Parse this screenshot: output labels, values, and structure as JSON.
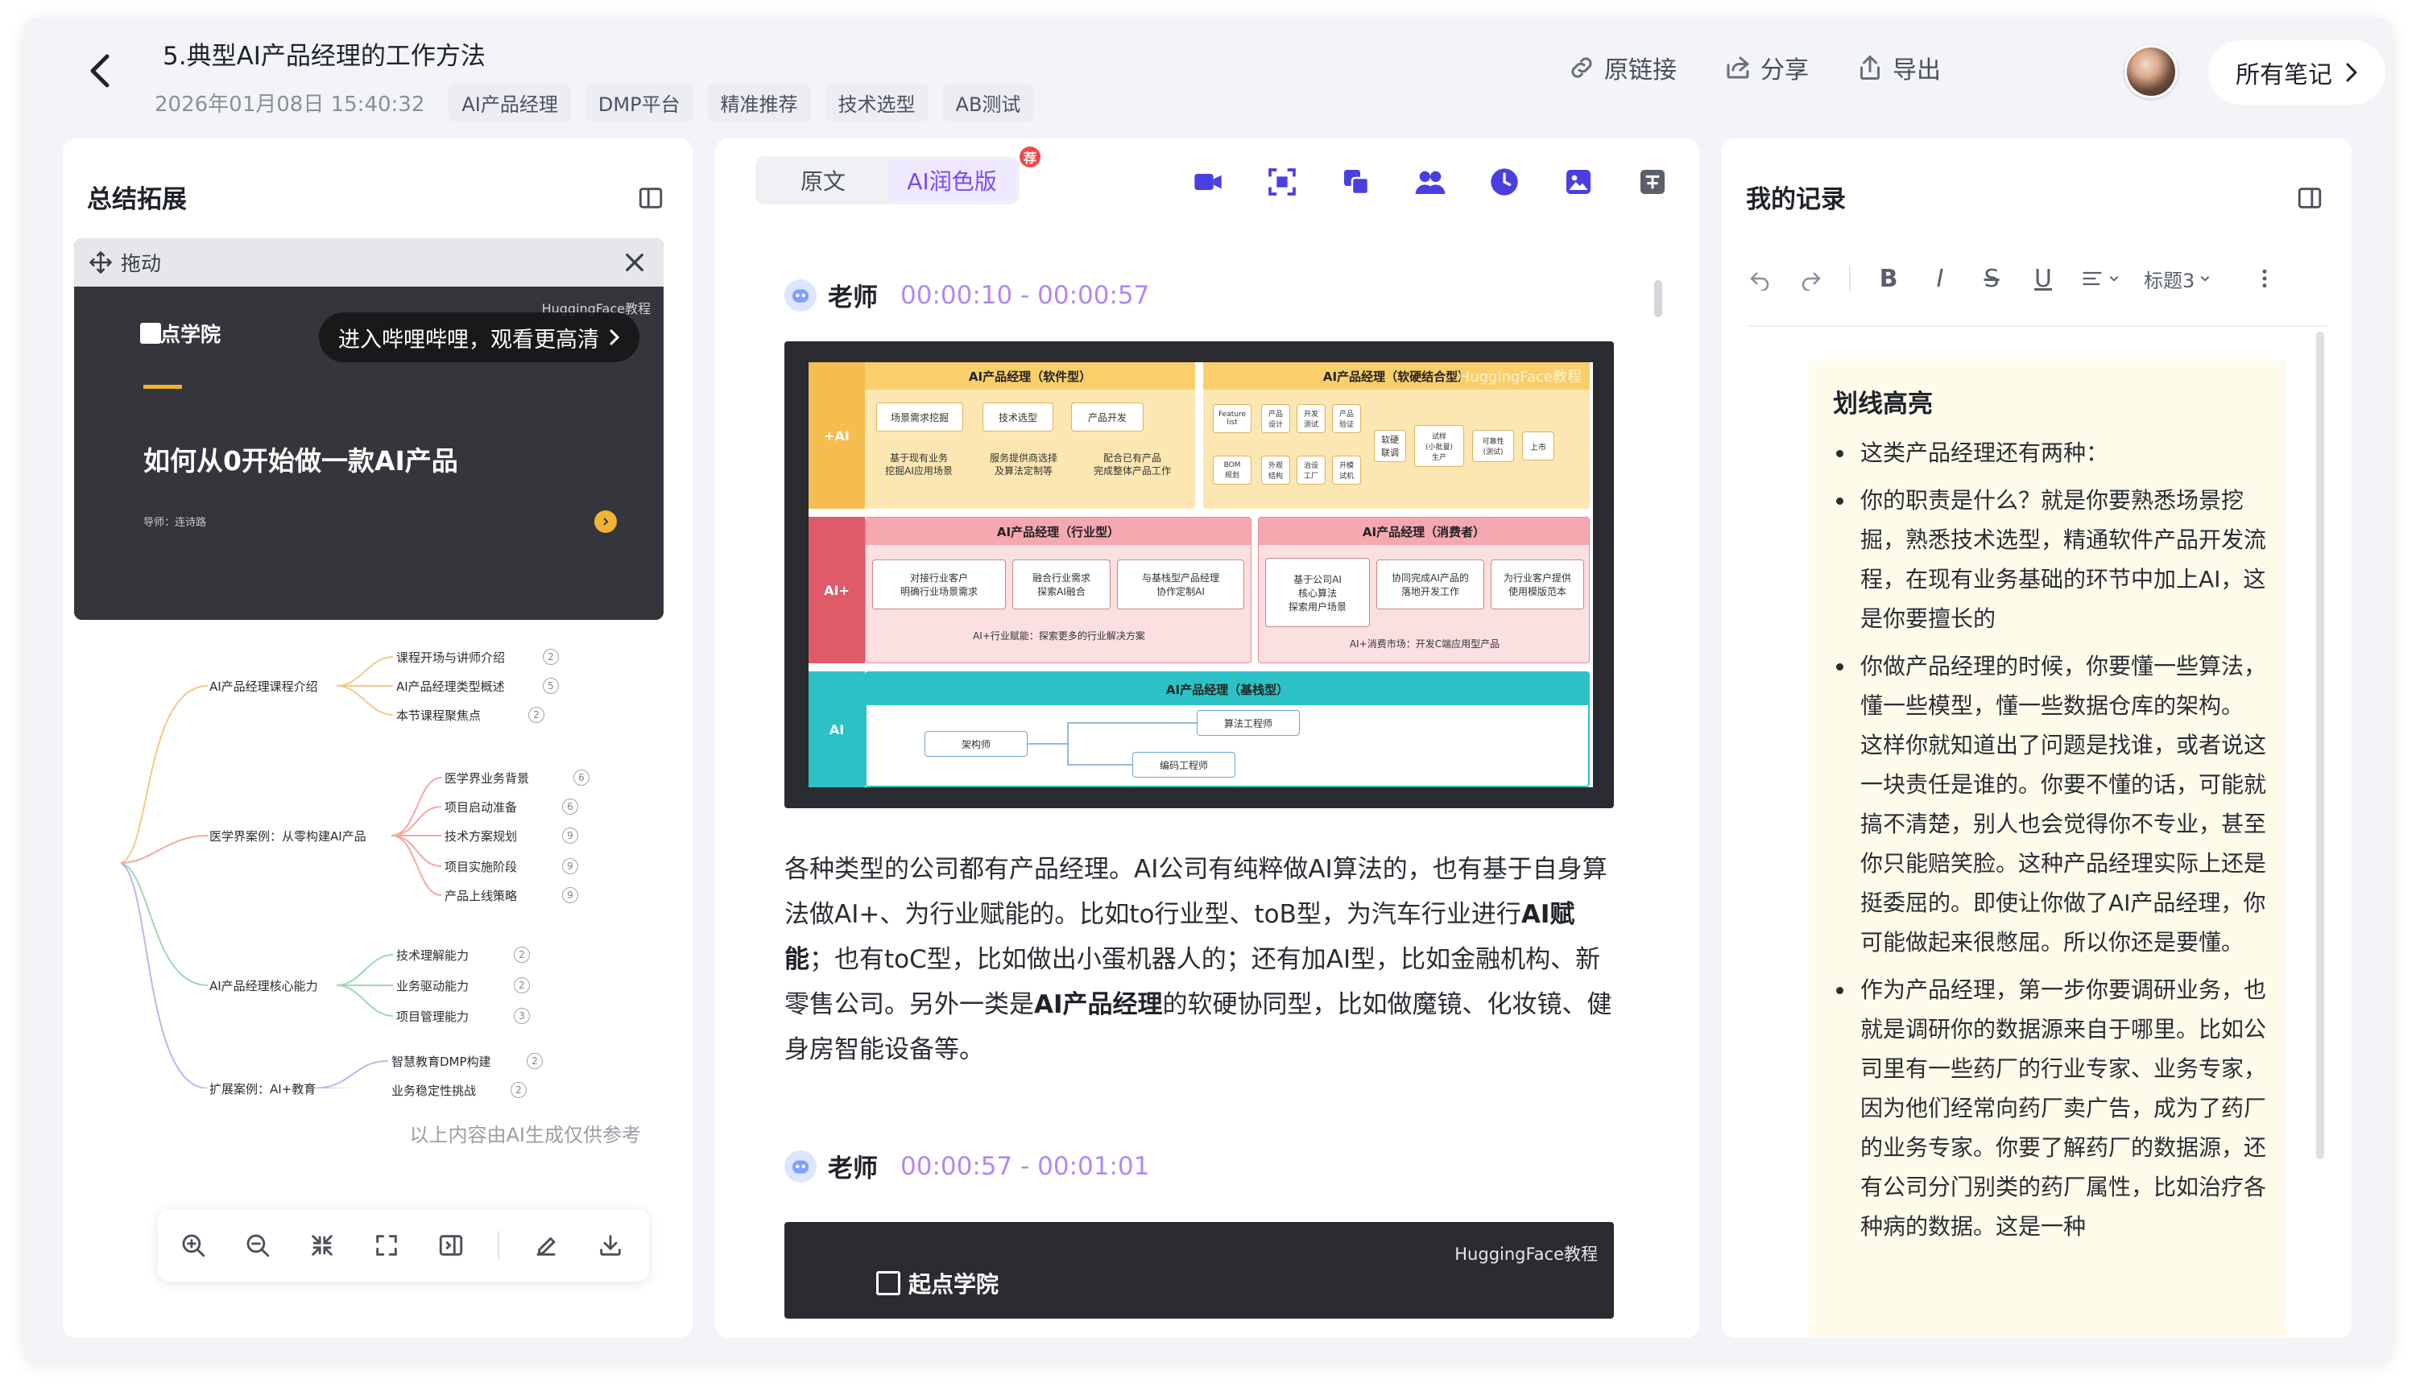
{
  "header": {
    "title": "5.典型AI产品经理的工作方法",
    "date": "2026年01月08日 15:40:32",
    "tags": [
      "AI产品经理",
      "DMP平台",
      "精准推荐",
      "技术选型",
      "AB测试"
    ],
    "actions": {
      "link": "原链接",
      "share": "分享",
      "export": "导出"
    },
    "all_notes": "所有笔记"
  },
  "left": {
    "title": "总结拓展",
    "video": {
      "drag_label": "拖动",
      "logo": "起点学院",
      "watermark": "HuggingFace教程",
      "bili_button": "进入哔哩哔哩，观看更高清",
      "heading": "如何从0开始做一款AI产品",
      "instructor": "导师：连诗路"
    },
    "mindmap": {
      "branches": [
        {
          "label": "AI产品经理课程介绍",
          "children": [
            {
              "label": "课程开场与讲师介绍",
              "n": "2"
            },
            {
              "label": "AI产品经理类型概述",
              "n": "5"
            },
            {
              "label": "本节课程聚焦点",
              "n": "2"
            }
          ]
        },
        {
          "label": "医学界案例：从零构建AI产品",
          "children": [
            {
              "label": "医学界业务背景",
              "n": "6"
            },
            {
              "label": "项目启动准备",
              "n": "6"
            },
            {
              "label": "技术方案规划",
              "n": "9"
            },
            {
              "label": "项目实施阶段",
              "n": "9"
            },
            {
              "label": "产品上线策略",
              "n": "9"
            }
          ]
        },
        {
          "label": "AI产品经理核心能力",
          "children": [
            {
              "label": "技术理解能力",
              "n": "2"
            },
            {
              "label": "业务驱动能力",
              "n": "2"
            },
            {
              "label": "项目管理能力",
              "n": "3"
            }
          ]
        },
        {
          "label": "扩展案例：AI+教育",
          "children": [
            {
              "label": "智慧教育DMP构建",
              "n": "2"
            },
            {
              "label": "业务稳定性挑战",
              "n": "2"
            }
          ]
        }
      ]
    },
    "ai_note": "以上内容由AI生成仅供参考"
  },
  "middle": {
    "tabs": {
      "original": "原文",
      "polished": "AI润色版"
    },
    "badge": "荐",
    "blocks": [
      {
        "speaker": "老师",
        "time": "00:00:10 - 00:00:57"
      },
      {
        "speaker": "老师",
        "time": "00:00:57 - 00:01:01"
      }
    ],
    "slide": {
      "watermark": "HuggingFace教程",
      "rows": [
        {
          "band": "+AI",
          "areas": [
            {
              "title": "AI产品经理（软件型）",
              "boxes": [
                "场景需求挖掘",
                "技术选型",
                "产品开发"
              ],
              "notes": [
                "基于现有业务\n挖掘AI应用场景",
                "服务提供商选择\n及算法定制等",
                "配合已有产品\n完成整体产品工作"
              ]
            },
            {
              "title": "AI产品经理（软硬结合型）",
              "boxes": [
                "Feature\nlist",
                "产品\n设计",
                "开发\n测试",
                "产品\n验证",
                "BOM\n规划",
                "外观\n结构",
                "治设\n工厂",
                "开模\n试机",
                "软硬\n联调",
                "试样\n(小批量)\n生产",
                "可靠性\n(测试)",
                "上市"
              ]
            }
          ]
        },
        {
          "band": "AI+",
          "areas": [
            {
              "title": "AI产品经理（行业型）",
              "boxes": [
                "对接行业客户\n明确行业场景需求",
                "融合行业需求\n探索AI融合",
                "与基栈型产品经理\n协作定制AI"
              ],
              "footer": "AI+行业赋能：探索更多的行业解决方案"
            },
            {
              "title": "AI产品经理（消费者）",
              "boxes": [
                "基于公司AI\n核心算法\n探索用户场景",
                "协同完成AI产品的\n落地开发工作",
                "为行业客户提供\n使用模版范本"
              ],
              "footer": "AI+消费市场：开发C端应用型产品"
            }
          ]
        },
        {
          "band": "AI",
          "areas": [
            {
              "title": "AI产品经理（基栈型）",
              "boxes": [
                "架构师",
                "算法工程师",
                "编码工程师"
              ]
            }
          ]
        }
      ]
    },
    "paragraph": {
      "p1": "各种类型的公司都有产品经理。AI公司有纯粹做AI算法的，也有基于自身算法做AI+、为行业赋能的。比如to行业型、toB型，为汽车行业进行",
      "b1": "AI赋能",
      "p2": "；也有toC型，比如做出小蛋机器人的；还有加AI型，比如金融机构、新零售公司。另外一类是",
      "b2": "AI产品经理",
      "p3": "的软硬协同型，比如做魔镜、化妆镜、健身房智能设备等。"
    },
    "slide2": {
      "logo": "起点学院",
      "watermark": "HuggingFace教程"
    }
  },
  "right": {
    "title": "我的记录",
    "heading_select": "标题3",
    "highlight_title": "划线高亮",
    "items": [
      "这类产品经理还有两种：",
      "你的职责是什么？就是你要熟悉场景挖掘，熟悉技术选型，精通软件产品开发流程，在现有业务基础的环节中加上AI，这是你要擅长的",
      "你做产品经理的时候，你要懂一些算法，懂一些模型，懂一些数据仓库的架构。 这样你就知道出了问题是找谁，或者说这一块责任是谁的。你要不懂的话，可能就搞不清楚，别人也会觉得你不专业，甚至你只能赔笑脸。这种产品经理实际上还是挺委屈的。即使让你做了AI产品经理，你可能做起来很憋屈。所以你还是要懂。",
      "作为产品经理，第一步你要调研业务，也就是调研你的数据源来自于哪里。比如公司里有一些药厂的行业专家、业务专家，因为他们经常向药厂卖广告，成为了药厂的业务专家。你要了解药厂的数据源，还有公司分门别类的药厂属性，比如治疗各种病的数据。这是一种"
    ]
  },
  "colors": {
    "accent": "#7a4bf0",
    "time": "#b487f2",
    "highlight_bg": "#fffbeb",
    "tool_blue": "#4a3fe0"
  }
}
